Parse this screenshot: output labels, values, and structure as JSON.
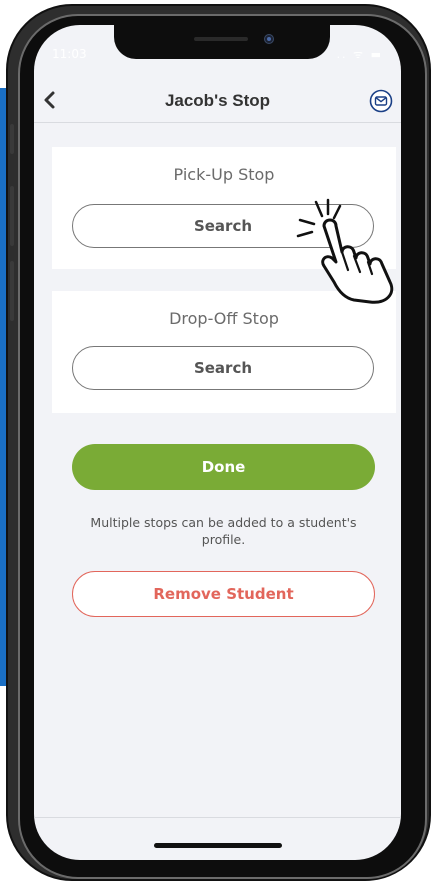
{
  "status_bar": {
    "time": "11:03",
    "signal": ".. ᯤ ▬"
  },
  "navbar": {
    "title": "Jacob's Stop",
    "back_icon": "chevron-left-icon",
    "mail_icon": "mail-icon"
  },
  "pickup": {
    "title": "Pick-Up Stop",
    "button_label": "Search"
  },
  "dropoff": {
    "title": "Drop-Off Stop",
    "button_label": "Search"
  },
  "done_label": "Done",
  "hint_text": "Multiple stops can be added to a student's profile.",
  "remove_label": "Remove Student",
  "colors": {
    "accent_green": "#7aab36",
    "danger": "#e2665b",
    "brand_blue": "#1a6fc4"
  },
  "overlay": {
    "icon": "tap-hand-icon"
  }
}
